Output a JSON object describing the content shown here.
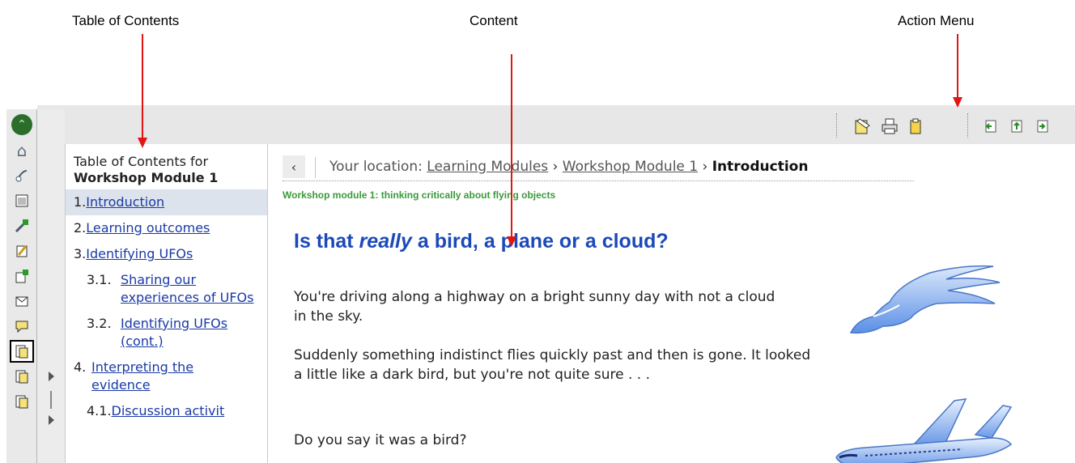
{
  "annotations": {
    "toc_label": "Table of Contents",
    "content_label": "Content",
    "action_menu_label": "Action Menu"
  },
  "toc": {
    "header_line1": "Table of Contents for",
    "header_line2": "Workshop Module 1",
    "items": [
      {
        "num": "1.",
        "label": "Introduction"
      },
      {
        "num": "2.",
        "label": "Learning outcomes"
      },
      {
        "num": "3.",
        "label": "Identifying UFOs"
      },
      {
        "num": "3.1.",
        "label": "Sharing our experiences of UFOs"
      },
      {
        "num": "3.2.",
        "label": "Identifying UFOs (cont.)"
      },
      {
        "num": "4.",
        "label": "Interpreting the evidence"
      },
      {
        "num": "4.1.",
        "label": "Discussion activit"
      }
    ]
  },
  "location": {
    "back_icon": "‹",
    "prefix": "Your location:",
    "crumb1": "Learning Modules",
    "sep1": "›",
    "crumb2": "Workshop Module 1",
    "sep2": "›",
    "current": "Introduction"
  },
  "content": {
    "subtitle": "Workshop module 1: thinking critically about flying objects",
    "heading_pre": "Is that ",
    "heading_em": "really",
    "heading_post": " a bird, a plane or a cloud?",
    "para1": "You're driving along a highway on a bright sunny day with not a cloud in the sky.",
    "para2": "Suddenly something indistinct flies quickly past and then is gone. It looked a little like a dark bird, but you're not quite sure . . .",
    "para3": "Do you say it was a bird?"
  },
  "icons": {
    "strip": [
      "collapse-icon",
      "home-icon",
      "satellite-icon",
      "calendar-icon",
      "new-tool-icon",
      "edit-icon",
      "add-page-icon",
      "mail-icon",
      "chat-icon",
      "content-icon",
      "pages-icon",
      "more-pages-icon"
    ],
    "actions": [
      "edit-page-icon",
      "print-icon",
      "notes-icon",
      "previous-icon",
      "up-icon",
      "next-icon"
    ]
  },
  "colors": {
    "heading": "#1b4ab8",
    "subtitle": "#3a9a3a",
    "link": "#1a3aa6",
    "arrow": "#e21414"
  }
}
